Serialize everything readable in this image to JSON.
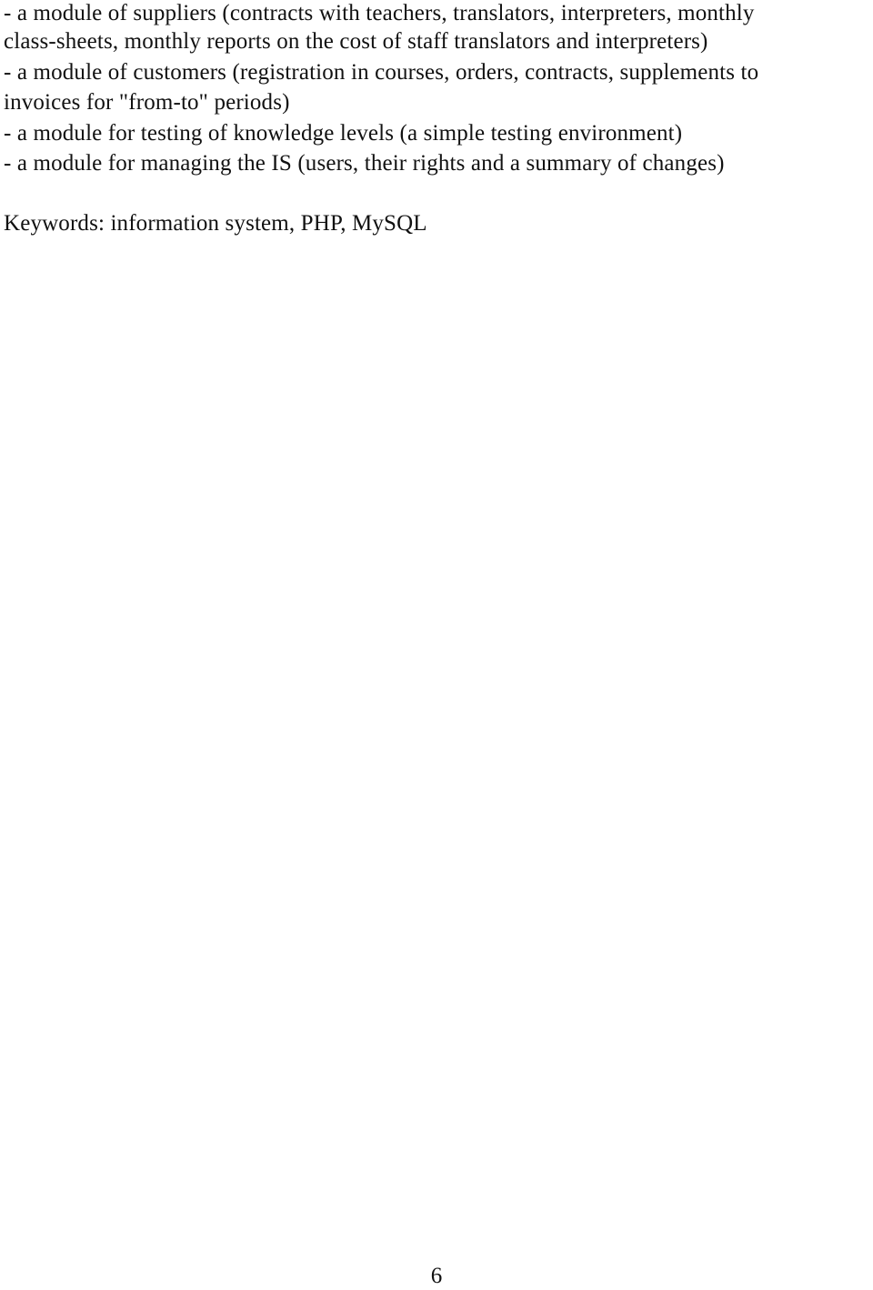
{
  "document": {
    "lines": [
      "- a module of suppliers (contracts with teachers, translators, interpreters, monthly",
      "class-sheets, monthly reports on the cost of staff translators and interpreters)",
      "- a module of customers (registration in courses, orders, contracts, supplements to",
      "invoices for \"from-to\" periods)",
      "- a module for testing of knowledge levels (a simple testing environment)",
      "- a module for managing the IS (users, their rights and a summary of changes)"
    ],
    "keywords": "Keywords: information system, PHP, MySQL",
    "page_number": "6"
  }
}
